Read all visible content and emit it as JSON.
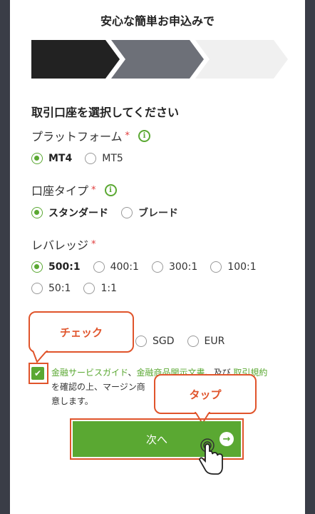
{
  "header": {
    "title": "安心な簡単お申込みで"
  },
  "section": {
    "title": "取引口座を選択してください"
  },
  "platform": {
    "label": "プラットフォーム",
    "required": "*",
    "options": [
      "MT4",
      "MT5"
    ],
    "selected": "MT4"
  },
  "account_type": {
    "label": "口座タイプ",
    "required": "*",
    "options": [
      "スタンダード",
      "ブレード"
    ],
    "selected": "スタンダード"
  },
  "leverage": {
    "label": "レバレッジ",
    "required": "*",
    "options": [
      "500:1",
      "400:1",
      "300:1",
      "100:1",
      "50:1",
      "1:1"
    ],
    "selected": "500:1"
  },
  "currency": {
    "options": [
      "SGD",
      "EUR"
    ]
  },
  "annotations": {
    "check": "チェック",
    "tap": "タップ"
  },
  "terms": {
    "link1": "金融サービスガイド",
    "sep1": "、",
    "link2": "金融商品開示文書",
    "sep2": "、及び",
    "link3": "取引規約",
    "line2": "を確認の上、マージン商",
    "line2_end": "、同",
    "line3": "意します。"
  },
  "next_button": {
    "label": "次へ",
    "arrow": "→"
  },
  "colors": {
    "accent": "#5aa832",
    "annotation": "#e0542b",
    "step_dark": "#222222",
    "step_mid": "#6d7078"
  }
}
